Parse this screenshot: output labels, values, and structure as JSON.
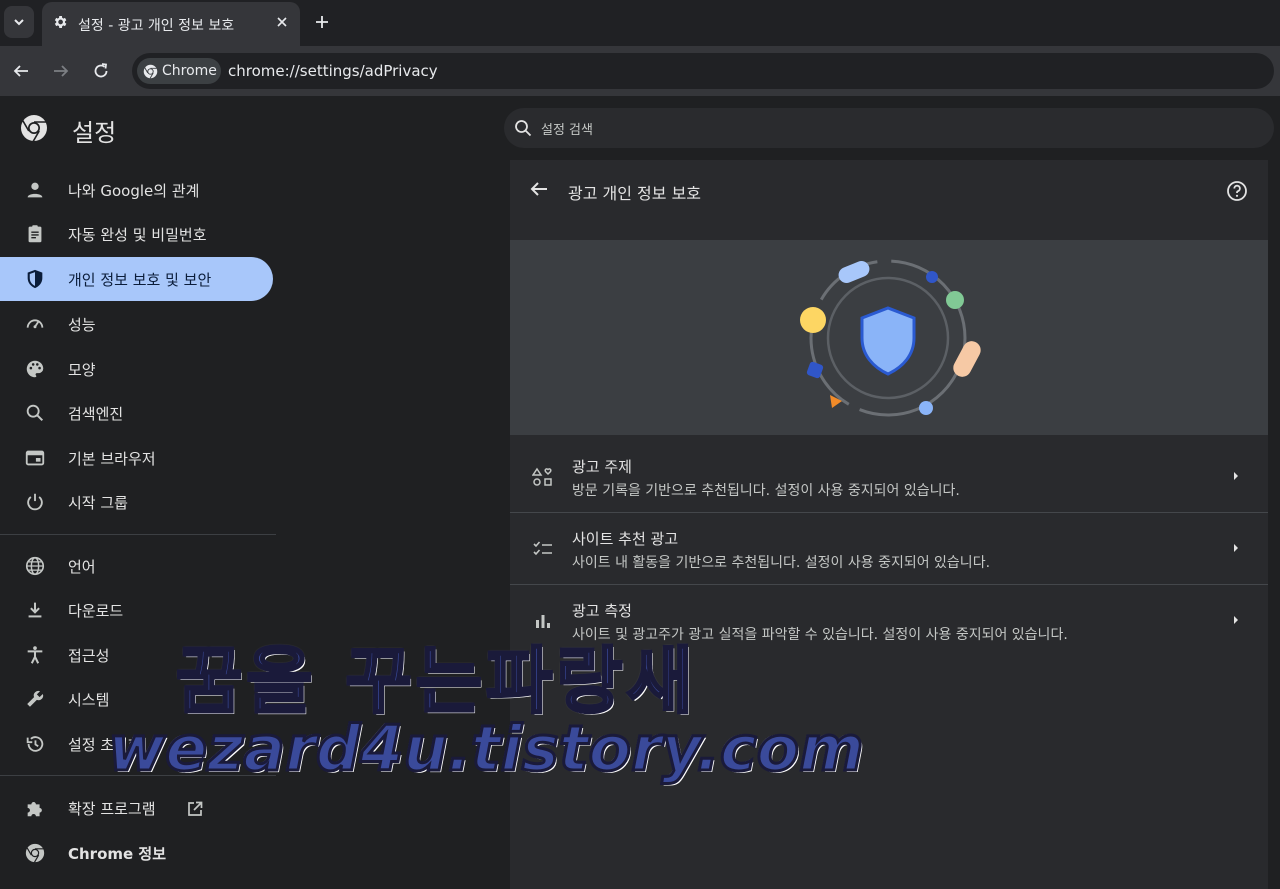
{
  "tab": {
    "title": "설정 - 광고 개인 정보 보호"
  },
  "omnibox": {
    "chip_label": "Chrome",
    "url": "chrome://settings/adPrivacy"
  },
  "header": {
    "title": "설정",
    "search_placeholder": "설정 검색"
  },
  "sidebar": {
    "items": [
      {
        "label": "나와 Google의 관계",
        "icon": "person-icon"
      },
      {
        "label": "자동 완성 및 비밀번호",
        "icon": "clipboard-icon"
      },
      {
        "label": "개인 정보 보호 및 보안",
        "icon": "shield-icon",
        "active": true
      },
      {
        "label": "성능",
        "icon": "speedometer-icon"
      },
      {
        "label": "모양",
        "icon": "palette-icon"
      },
      {
        "label": "검색엔진",
        "icon": "search-icon"
      },
      {
        "label": "기본 브라우저",
        "icon": "browser-icon"
      },
      {
        "label": "시작 그룹",
        "icon": "power-icon"
      },
      {
        "label": "언어",
        "icon": "globe-icon"
      },
      {
        "label": "다운로드",
        "icon": "download-icon"
      },
      {
        "label": "접근성",
        "icon": "accessibility-icon"
      },
      {
        "label": "시스템",
        "icon": "wrench-icon"
      },
      {
        "label": "설정 초기화",
        "icon": "history-icon"
      },
      {
        "label": "확장 프로그램",
        "icon": "puzzle-icon"
      },
      {
        "label": "Chrome 정보",
        "icon": "chrome-icon"
      }
    ]
  },
  "page": {
    "title": "광고 개인 정보 보호",
    "rows": [
      {
        "title": "광고 주제",
        "description": "방문 기록을 기반으로 추천됩니다. 설정이 사용 중지되어 있습니다."
      },
      {
        "title": "사이트 추천 광고",
        "description": "사이트 내 활동을 기반으로 추천됩니다. 설정이 사용 중지되어 있습니다."
      },
      {
        "title": "광고 측정",
        "description": "사이트 및 광고주가 광고 실적을 파악할 수 있습니다. 설정이 사용 중지되어 있습니다."
      }
    ]
  },
  "watermark": {
    "line1": "꿈을 꾸는파랑새",
    "line2": "wezard4u.tistory.com"
  },
  "colors": {
    "accent": "#a8c7fa",
    "background": "#1f2022",
    "card": "#292a2d"
  }
}
